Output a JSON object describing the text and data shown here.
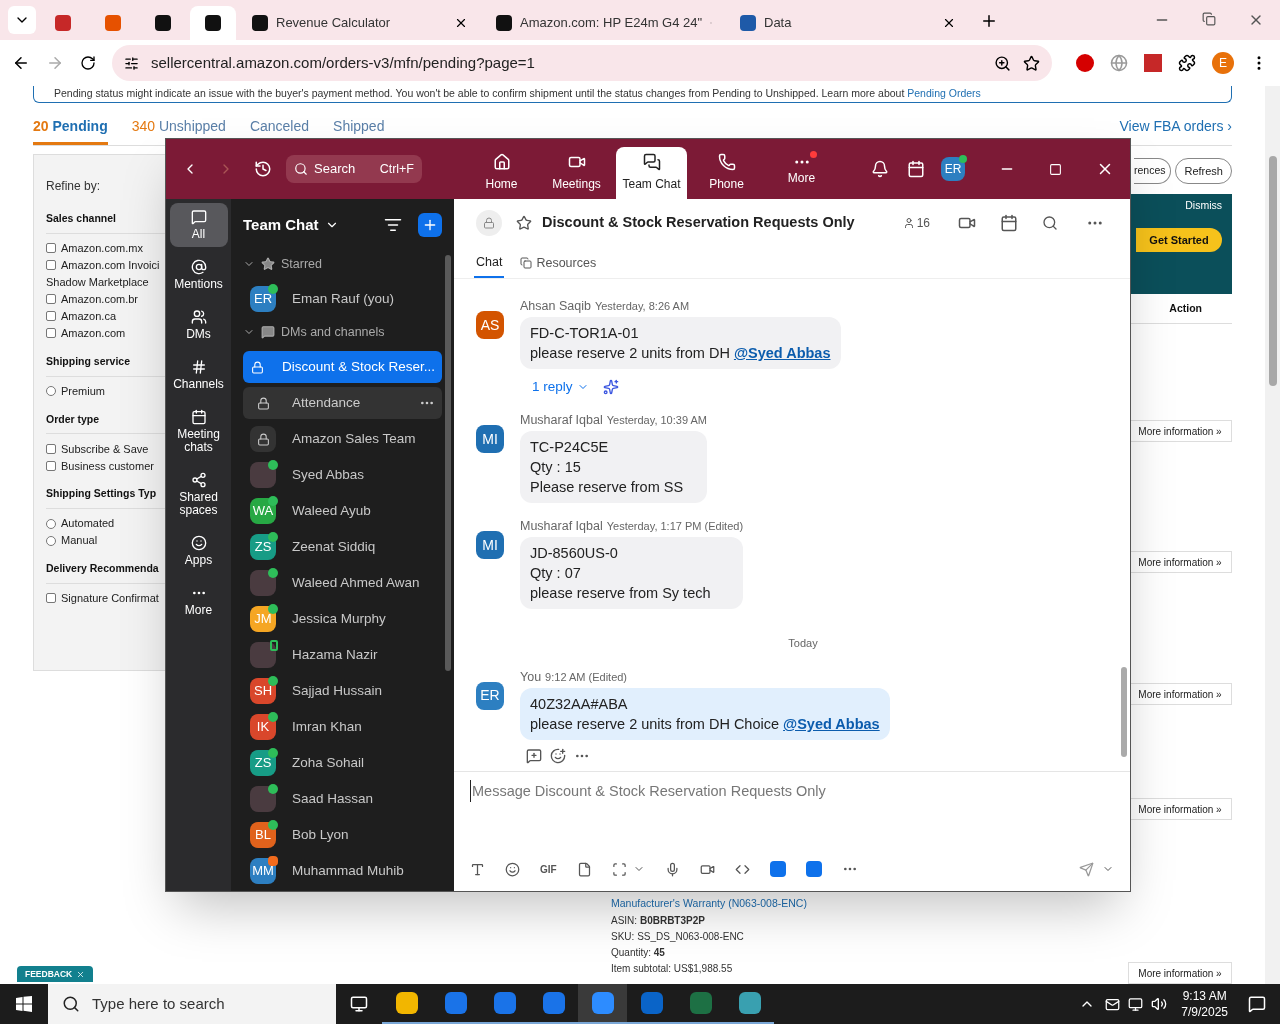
{
  "browser": {
    "tabs": [
      {
        "selected": false
      },
      {
        "selected": false
      },
      {
        "selected": false
      },
      {
        "selected": true
      },
      {
        "label": "Revenue Calculator",
        "selected": false
      },
      {
        "label": "Amazon.com: HP E24m G4 24\"",
        "selected": false
      },
      {
        "label": "Data",
        "selected": false
      }
    ],
    "address": "sellercentral.amazon.com/orders-v3/mfn/pending?page=1",
    "profile": "E"
  },
  "page": {
    "notice": {
      "text": "Pending status might indicate an issue with the buyer's payment method. You won't be able to confirm shipment until the status changes from Pending to Unshipped. Learn more about",
      "link": "Pending Orders"
    },
    "order_tabs": [
      {
        "count": "20",
        "label": "Pending",
        "selected": true
      },
      {
        "count": "340",
        "label": "Unshipped",
        "selected": false
      },
      {
        "label": "Canceled",
        "selected": false
      },
      {
        "label": "Shipped",
        "selected": false
      }
    ],
    "fba_link": "View FBA orders ›",
    "refine_title": "Refine by:",
    "filters": [
      {
        "title": "Sales channel",
        "options": [
          {
            "kind": "checkbox",
            "label": "Amazon.com.mx",
            "checked": false
          },
          {
            "kind": "checkbox",
            "label": "Amazon.com Invoici",
            "label_line2": "Shadow Marketplace",
            "checked": false
          },
          {
            "kind": "checkbox",
            "label": "Amazon.com.br",
            "checked": false
          },
          {
            "kind": "checkbox",
            "label": "Amazon.ca",
            "checked": false
          },
          {
            "kind": "checkbox",
            "label": "Amazon.com",
            "checked": false
          }
        ]
      },
      {
        "title": "Shipping service",
        "options": [
          {
            "kind": "radio",
            "label": "Premium",
            "checked": false
          }
        ]
      },
      {
        "title": "Order type",
        "options": [
          {
            "kind": "checkbox",
            "label": "Subscribe & Save",
            "checked": false
          },
          {
            "kind": "checkbox",
            "label": "Business customer",
            "checked": false
          }
        ]
      },
      {
        "title": "Shipping Settings Typ",
        "options": [
          {
            "kind": "radio",
            "label": "Automated",
            "checked": false
          },
          {
            "kind": "radio",
            "label": "Manual",
            "checked": false
          }
        ]
      },
      {
        "title": "Delivery Recommenda",
        "options": [
          {
            "kind": "checkbox",
            "label": "Signature Confirmat",
            "checked": false
          }
        ]
      }
    ],
    "toolbar_buttons": [
      "rences",
      "Refresh"
    ],
    "promo": {
      "dismiss": "Dismiss",
      "cta": "Get Started"
    },
    "action_header": "Action",
    "more_info_buttons": [
      "More information »",
      "More information »",
      "More information »",
      "More information »",
      "More information »"
    ],
    "order_details": {
      "link": "Manufacturer's Warranty (N063-008-ENC)",
      "fields": [
        {
          "label": "ASIN:",
          "value": "B0BRBT3P2P",
          "emphasis": true
        },
        {
          "label": "SKU:",
          "value": "SS_DS_N063-008-ENC",
          "emphasis": false
        },
        {
          "label": "Quantity:",
          "value": "45",
          "emphasis": true
        },
        {
          "label": "Item subtotal:",
          "value": "US$1,988.55",
          "emphasis": false
        }
      ]
    },
    "feedback": "FEEDBACK"
  },
  "zoom": {
    "search": {
      "placeholder": "Search",
      "shortcut": "Ctrl+F"
    },
    "nav": [
      {
        "label": "Home",
        "selected": false,
        "notification": false
      },
      {
        "label": "Meetings",
        "selected": false,
        "notification": false
      },
      {
        "label": "Team Chat",
        "selected": true,
        "notification": false
      },
      {
        "label": "Phone",
        "selected": false,
        "notification": false
      },
      {
        "label": "More",
        "selected": false,
        "notification": true
      }
    ],
    "avatar": "ER",
    "rail": [
      {
        "label": "All",
        "selected": true
      },
      {
        "label": "Mentions",
        "selected": false
      },
      {
        "label": "DMs",
        "selected": false
      },
      {
        "label": "Channels",
        "selected": false
      },
      {
        "label": "Meeting chats",
        "selected": false
      },
      {
        "label": "Shared spaces",
        "selected": false
      },
      {
        "label": "Apps",
        "selected": false
      },
      {
        "label": "More",
        "selected": false
      }
    ],
    "sidebar": {
      "title": "Team Chat",
      "sections": [
        {
          "kind": "starred",
          "title": "Starred",
          "expanded": true,
          "items": [
            {
              "kind": "person",
              "name": "Eman Rauf (you)",
              "initials": "ER",
              "color": "#2d7fc1",
              "status": {
                "kind": "dot",
                "color": "#2ebd59"
              },
              "selected": false,
              "hovered": false
            }
          ]
        },
        {
          "kind": "chats",
          "title": "DMs and channels",
          "expanded": true,
          "items": [
            {
              "kind": "channel",
              "name": "Discount & Stock Reser...",
              "selected": true,
              "hovered": false
            },
            {
              "kind": "channel",
              "name": "Attendance",
              "selected": false,
              "hovered": true
            },
            {
              "kind": "channel",
              "name": "Amazon Sales Team",
              "selected": false,
              "hovered": false
            },
            {
              "kind": "photo",
              "name": "Syed Abbas",
              "status": {
                "kind": "dot",
                "color": "#2ebd59"
              },
              "selected": false,
              "hovered": false
            },
            {
              "kind": "person",
              "name": "Waleed Ayub",
              "initials": "WA",
              "color": "#27a844",
              "status": {
                "kind": "dot",
                "color": "#2ebd59"
              },
              "selected": false,
              "hovered": false
            },
            {
              "kind": "person",
              "name": "Zeenat Siddiq",
              "initials": "ZS",
              "color": "#179c86",
              "status": {
                "kind": "dot",
                "color": "#2ebd59"
              },
              "selected": false,
              "hovered": false
            },
            {
              "kind": "photo",
              "name": "Waleed Ahmed Awan",
              "status": {
                "kind": "dot",
                "color": "#2ebd59"
              },
              "selected": false,
              "hovered": false
            },
            {
              "kind": "person",
              "name": "Jessica Murphy",
              "initials": "JM",
              "color": "#f5a623",
              "status": {
                "kind": "dot",
                "color": "#2ebd59"
              },
              "selected": false,
              "hovered": false
            },
            {
              "kind": "photo",
              "name": "Hazama Nazir",
              "status": {
                "kind": "mobile",
                "color": "#2ebd59"
              },
              "selected": false,
              "hovered": false
            },
            {
              "kind": "person",
              "name": "Sajjad Hussain",
              "initials": "SH",
              "color": "#d9472b",
              "status": {
                "kind": "dot",
                "color": "#2ebd59"
              },
              "selected": false,
              "hovered": false
            },
            {
              "kind": "person",
              "name": "Imran Khan",
              "initials": "IK",
              "color": "#d9472b",
              "status": {
                "kind": "dot",
                "color": "#2ebd59"
              },
              "selected": false,
              "hovered": false
            },
            {
              "kind": "person",
              "name": "Zoha Sohail",
              "initials": "ZS",
              "color": "#179c86",
              "status": {
                "kind": "dot",
                "color": "#2ebd59"
              },
              "selected": false,
              "hovered": false
            },
            {
              "kind": "photo",
              "name": "Saad Hassan",
              "status": {
                "kind": "dot",
                "color": "#2ebd59"
              },
              "selected": false,
              "hovered": false
            },
            {
              "kind": "person",
              "name": "Bob Lyon",
              "initials": "BL",
              "color": "#e0621c",
              "status": {
                "kind": "dot",
                "color": "#2ebd59"
              },
              "selected": false,
              "hovered": false
            },
            {
              "kind": "person",
              "name": "Muhammad Muhib",
              "initials": "MM",
              "color": "#2d7fc1",
              "status": {
                "kind": "meeting",
                "color": "#f26b1d"
              },
              "selected": false,
              "hovered": false
            }
          ]
        }
      ]
    },
    "channel": {
      "title": "Discount & Stock Reservation Requests Only",
      "members": "16"
    },
    "tabs": [
      {
        "label": "Chat",
        "selected": true
      },
      {
        "label": "Resources",
        "selected": false
      }
    ],
    "messages": [
      {
        "kind": "message",
        "sender": "Ahsan Saqib",
        "time": "Yesterday, 8:26 AM",
        "initials": "AS",
        "color": "#d35400",
        "own": false,
        "lines": [
          {
            "text": "FD-C-TOR1A-01"
          },
          {
            "text": "please reserve 2 units from DH ",
            "mention": "@Syed Abbas"
          }
        ],
        "replies": "1 reply"
      },
      {
        "kind": "message",
        "sender": "Musharaf Iqbal",
        "time": "Yesterday, 10:39 AM",
        "initials": "MI",
        "color": "#1f6fb2",
        "own": false,
        "lines": [
          {
            "text": "TC-P24C5E"
          },
          {
            "text": "Qty : 15"
          },
          {
            "text": "Please reserve from SS"
          }
        ]
      },
      {
        "kind": "message",
        "sender": "Musharaf Iqbal",
        "time": "Yesterday, 1:17 PM (Edited)",
        "initials": "MI",
        "color": "#1f6fb2",
        "own": false,
        "lines": [
          {
            "text": "JD-8560US-0"
          },
          {
            "text": "Qty : 07"
          },
          {
            "text": "please reserve from Sy tech"
          }
        ]
      },
      {
        "kind": "divider",
        "label": "Today"
      },
      {
        "kind": "message",
        "sender": "You",
        "time": "9:12 AM (Edited)",
        "initials": "ER",
        "color": "#2d7fc1",
        "own": true,
        "lines": [
          {
            "text": "40Z32AA#ABA"
          },
          {
            "text": "please reserve 2 units from DH Choice ",
            "mention": "@Syed Abbas"
          }
        ]
      }
    ],
    "compose_placeholder": "Message Discount & Stock Reservation Requests Only",
    "gif": "GIF"
  },
  "taskbar": {
    "search_placeholder": "Type here to search",
    "apps": [
      {
        "selected": false
      },
      {
        "selected": false
      },
      {
        "selected": false
      },
      {
        "selected": false
      },
      {
        "selected": true
      },
      {
        "selected": false
      },
      {
        "selected": false
      },
      {
        "selected": false
      }
    ],
    "time": "9:13 AM",
    "date": "7/9/2025"
  }
}
